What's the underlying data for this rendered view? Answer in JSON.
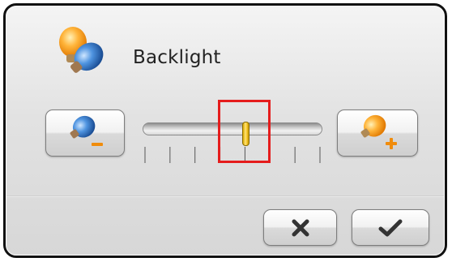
{
  "dialog": {
    "title": "Backlight",
    "title_icon": "backlight-bulbs-icon"
  },
  "controls": {
    "decrease_icon": "bulb-minus-icon",
    "increase_icon": "bulb-plus-icon",
    "slider": {
      "level": 0.57,
      "tick_count": 8
    }
  },
  "footer": {
    "cancel_icon": "x-icon",
    "confirm_icon": "checkmark-icon"
  },
  "colors": {
    "highlight": "#e51c1c",
    "bulb_orange": "#f39a1e",
    "bulb_blue": "#2f6fb8"
  }
}
